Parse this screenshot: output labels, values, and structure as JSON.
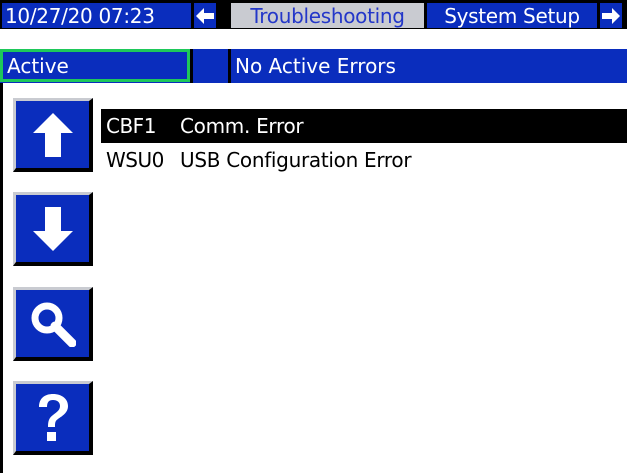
{
  "header": {
    "datetime": "10/27/20 07:23",
    "nav_prev_icon": "arrow-left-icon",
    "nav_next_icon": "arrow-right-icon",
    "tabs": [
      {
        "label": "Troubleshooting",
        "active": true
      },
      {
        "label": "System Setup",
        "active": false
      }
    ]
  },
  "status": {
    "state": "Active",
    "message": "No Active Errors"
  },
  "side_buttons": [
    {
      "icon": "arrow-up-icon"
    },
    {
      "icon": "arrow-down-icon"
    },
    {
      "icon": "magnifier-icon"
    },
    {
      "icon": "question-mark-icon"
    }
  ],
  "errors": [
    {
      "code": "CBF1",
      "description": "Comm. Error",
      "selected": true
    },
    {
      "code": "WSU0",
      "description": "USB Configuration Error",
      "selected": false
    }
  ],
  "colors": {
    "primary_blue": "#0a2dbd",
    "active_tab_bg": "#c9cbd1",
    "active_tab_text": "#2337c9",
    "status_active_border": "#1ec85a",
    "selection_bg": "#000000"
  }
}
